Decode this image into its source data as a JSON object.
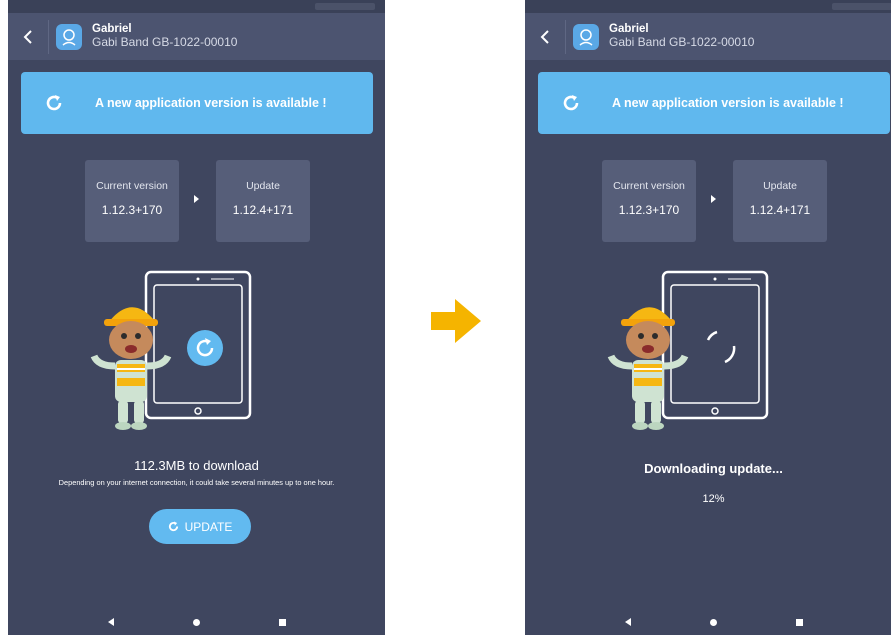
{
  "header": {
    "user_name": "Gabriel",
    "device_name": "Gabi Band GB-1022-00010"
  },
  "banner": {
    "text": "A new application version is available !"
  },
  "versions": {
    "current_label": "Current version",
    "current_value": "1.12.3+170",
    "update_label": "Update",
    "update_value": "1.12.4+171"
  },
  "before": {
    "download_size": "112.3MB to download",
    "note": "Depending on your internet connection, it could take several minutes up to one hour.",
    "update_button": "UPDATE"
  },
  "after": {
    "status": "Downloading update...",
    "progress_text": "12%",
    "progress": 0.12
  },
  "colors": {
    "background": "#3f465f",
    "header": "#4c5470",
    "accent": "#60b8ee",
    "version_box": "#565e79",
    "transition_arrow": "#f5b400"
  },
  "icons": {
    "back": "chevron-left-icon",
    "avatar": "user-icon",
    "refresh": "refresh-icon",
    "spinner": "spinner-icon",
    "transition": "arrow-right-icon"
  }
}
